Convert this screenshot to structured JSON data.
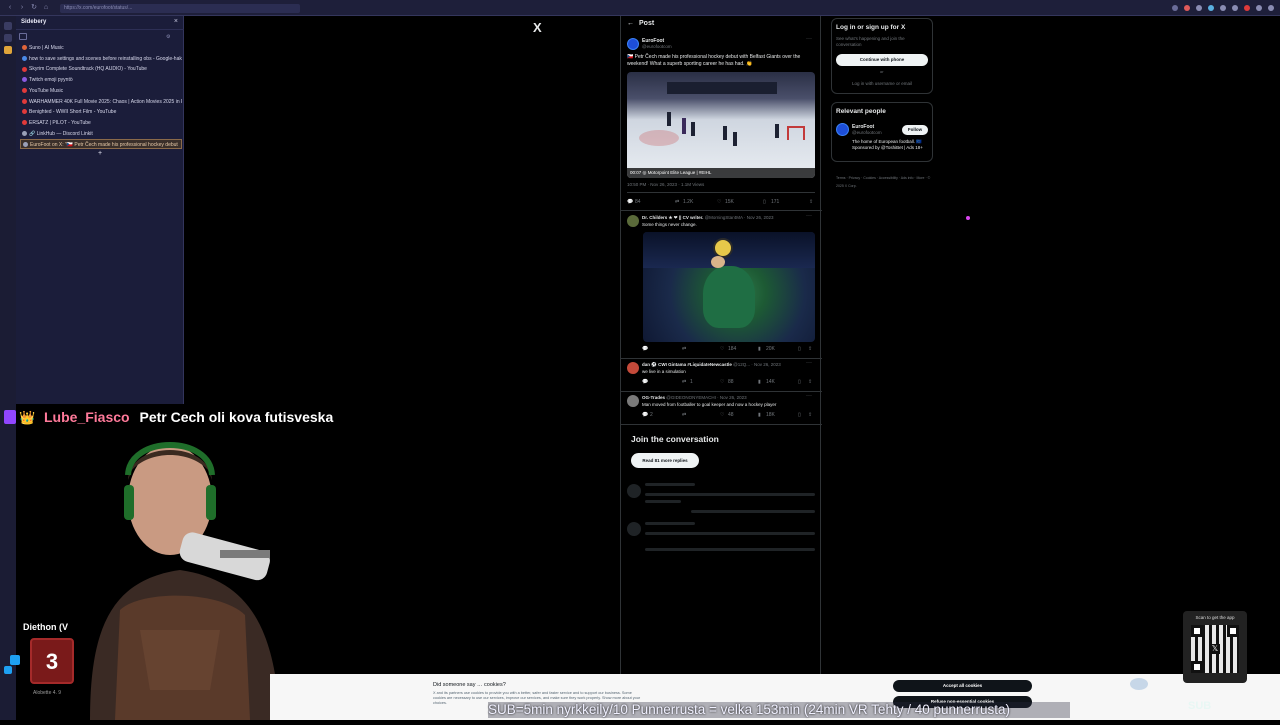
{
  "browser": {
    "url": "https://x.com/eurofoot/status/..."
  },
  "sidebery": {
    "title": "Sidebery",
    "close_glyph": "×",
    "tabs": [
      {
        "label": "Suno | AI Music",
        "color": "#e0653a"
      },
      {
        "label": "how to save settings and scenes before reinstalling obs - Google-haku",
        "color": "#4a8ae8"
      },
      {
        "label": "Skyrim Complete Soundtrack (HQ AUDIO) - YouTube",
        "color": "#e03a3a"
      },
      {
        "label": "Twitch emoji pyyntö",
        "color": "#8a5ae0"
      },
      {
        "label": "YouTube Music",
        "color": "#e03a3a"
      },
      {
        "label": "WARHAMMER 40K Full Movie 2025: Chaos | Action Movies 2025 in En",
        "color": "#e03a3a"
      },
      {
        "label": "Benighted - WWII Short Film - YouTube",
        "color": "#e03a3a"
      },
      {
        "label": "ERSATZ | PILOT - YouTube",
        "color": "#e03a3a"
      },
      {
        "label": "🔗 LinkHub — Discord Linkit",
        "color": "#9aa0b8"
      },
      {
        "label": "EuroFoot on X: \"🇨🇿 Petr Čech made his professional hockey debut",
        "color": "#9aa0b8",
        "active": true
      }
    ]
  },
  "x_logo": "X",
  "post": {
    "back_glyph": "←",
    "header": "Post",
    "author_name": "EuroFoot",
    "author_handle": "@eurofootcom",
    "text": "🇨🇿 Petr Čech made his professional hockey debut with Belfast Giants over the weekend! What a superb sporting career he has had. 👏",
    "video_caption": "00:07  ◎ Motorpoint Elite League | #EIHL",
    "meta": "10:50 PM · Nov 26, 2023 · 1.1M Views",
    "stats": {
      "replies": "84",
      "reposts": "1.2K",
      "likes": "15K",
      "bookmarks": "171"
    }
  },
  "replies": [
    {
      "name": "Dr. Childers ★ ❤ || CV writer.",
      "handle": "@MorningStar4MA · Nov 26, 2023",
      "text": "Some things never change.",
      "stats": {
        "replies": "",
        "reposts": "",
        "likes": "184",
        "views": "20K"
      }
    },
    {
      "name": "dan ⚽ CWI Gintama #LiquidateNewcastle",
      "handle": "@12Q... · Nov 26, 2023",
      "text": "we live in a simulation",
      "stats": {
        "replies": "",
        "reposts": "1",
        "likes": "88",
        "views": "14K"
      }
    },
    {
      "name": "OG-Trades",
      "handle": "@GIDEONONYEMACHI · Nov 26, 2023",
      "text": "Man moved from footballer to goal keeper and now a hockey player",
      "stats": {
        "replies": "2",
        "reposts": "",
        "likes": "48",
        "views": "18K"
      }
    }
  ],
  "join": {
    "title": "Join the conversation",
    "button": "Read 81 more replies"
  },
  "right": {
    "login_title": "Log in or sign up for X",
    "login_sub": "See what's happening and join the conversation",
    "phone_button": "Continue with phone",
    "or": "or",
    "login_alt": "Log in with username or email",
    "relevant_title": "Relevant people",
    "person_name": "EuroFoot",
    "person_handle": "@eurofootcom",
    "person_bio": "The home of European football. 🇪🇺 Sponsored by @ToshiBet | Ads 18+",
    "follow": "Follow",
    "footer": "Terms · Privacy · Cookies · Accessibility · Ads info · More · © 2025 X Corp."
  },
  "chat": {
    "user": "Lube_Fiasco",
    "message": "Petr Cech oli kova futisveska",
    "user_color": "#ff7a9a"
  },
  "stream": {
    "bottom_left_label": "Diethon (V",
    "counter": "3",
    "bottom_caption": "Alobette 4. 9",
    "sub_banner": "SUB=5min nyrkkeily/10 Punnerrusta = velka 153min (24min VR Tehty / 40 punnerrusta)",
    "sub_logo": "SUB"
  },
  "cookie": {
    "title": "Did someone say … cookies?",
    "body": "X and its partners use cookies to provide you with a better, safer and faster service and to support our business. Some cookies are necessary to use our services, improve our services, and make sure they work properly. Show more about your choices.",
    "accept": "Accept all cookies",
    "refuse": "Refuse non-essential cookies"
  },
  "qr": {
    "label": "Scan to get the app"
  }
}
